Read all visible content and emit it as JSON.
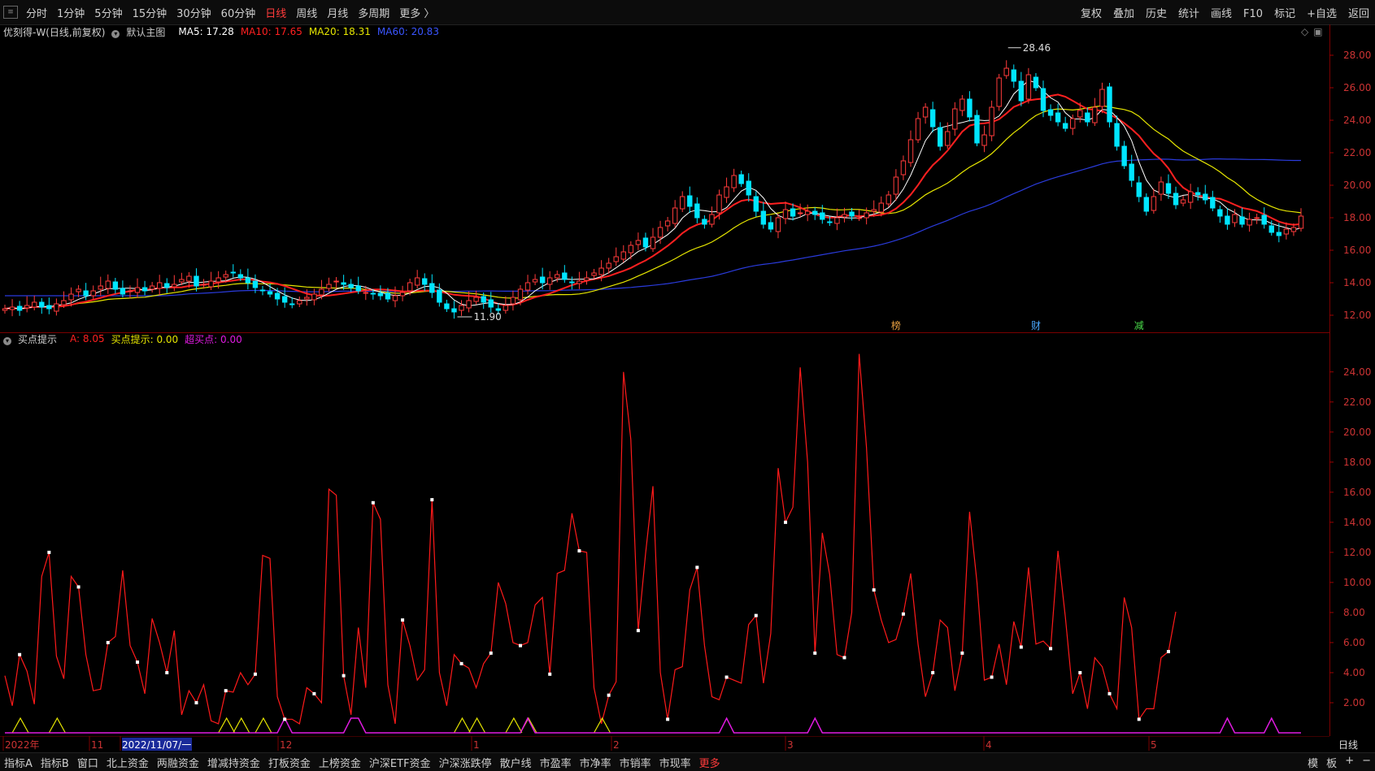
{
  "toolbar": {
    "periods": [
      "分时",
      "1分钟",
      "5分钟",
      "15分钟",
      "30分钟",
      "60分钟",
      "日线",
      "周线",
      "月线",
      "多周期",
      "更多 〉"
    ],
    "active_period": "日线",
    "right_items": [
      "复权",
      "叠加",
      "历史",
      "统计",
      "画线",
      "F10",
      "标记",
      "+自选",
      "返回"
    ]
  },
  "main_panel": {
    "title": "优刻得-W(日线,前复权)",
    "indicator_name": "默认主图",
    "ma5": "MA5: 17.28",
    "ma10": "MA10: 17.65",
    "ma20": "MA20: 18.31",
    "ma60": "MA60: 20.83",
    "high_label": "28.46",
    "low_label": "11.90",
    "y_ticks": [
      "28.00",
      "26.00",
      "24.00",
      "22.00",
      "20.00",
      "18.00",
      "16.00",
      "14.00",
      "12.00"
    ],
    "markers": [
      "榜",
      "财",
      "减"
    ]
  },
  "sub_panel": {
    "indicator_name": "买点提示",
    "a_value": "A: 8.05",
    "buy_hint": "买点提示: 0.00",
    "super_buy": "超买点: 0.00",
    "y_ticks": [
      "24.00",
      "22.00",
      "20.00",
      "18.00",
      "16.00",
      "14.00",
      "12.00",
      "10.00",
      "8.00",
      "6.00",
      "4.00",
      "2.00"
    ]
  },
  "x_axis": {
    "labels": [
      "2022年",
      "11",
      "2022/11/07/一",
      "12",
      "1",
      "2",
      "3",
      "4",
      "5"
    ],
    "period_label": "日线"
  },
  "bottom_tabs": [
    "指标A",
    "指标B",
    "窗口",
    "北上资金",
    "两融资金",
    "增减持资金",
    "打板资金",
    "上榜资金",
    "沪深ETF资金",
    "沪深涨跌停",
    "散户线",
    "市盈率",
    "市净率",
    "市销率",
    "市现率",
    "更多"
  ],
  "bottom_right": [
    "模",
    "板",
    "+",
    "−"
  ],
  "colors": {
    "ma5": "#ffffff",
    "ma10": "#ff2020",
    "ma20": "#e6e600",
    "ma60": "#2a3bdc",
    "up": "#ff3b3b",
    "down": "#00e5ff",
    "indicator": "#ff1a1a",
    "buy": "#e6e600",
    "superbuy": "#e01ae0"
  },
  "chart_data": {
    "type": "candlestick",
    "title": "优刻得-W(日线,前复权)",
    "y_range": [
      11.0,
      29.0
    ],
    "extremes": {
      "high": 28.46,
      "low": 11.9
    },
    "ma_values": {
      "MA5": 17.28,
      "MA10": 17.65,
      "MA20": 18.31,
      "MA60": 20.83
    },
    "closes": [
      12.4,
      12.5,
      12.3,
      12.6,
      12.8,
      12.5,
      12.4,
      12.7,
      12.9,
      13.3,
      13.6,
      13.2,
      13.5,
      13.8,
      14.1,
      13.6,
      13.3,
      13.5,
      13.7,
      13.5,
      13.8,
      14.0,
      13.7,
      13.9,
      14.2,
      14.4,
      13.8,
      13.9,
      14.1,
      14.3,
      14.5,
      14.6,
      14.3,
      14.0,
      13.7,
      13.5,
      13.3,
      13.0,
      12.8,
      12.7,
      12.9,
      13.1,
      13.3,
      13.6,
      13.9,
      14.1,
      13.9,
      13.7,
      13.5,
      13.4,
      13.3,
      13.2,
      13.0,
      13.2,
      13.4,
      14.0,
      14.3,
      13.9,
      13.4,
      12.8,
      12.4,
      12.2,
      12.6,
      12.9,
      13.1,
      12.8,
      12.5,
      12.3,
      12.6,
      13.1,
      13.6,
      14.0,
      14.2,
      14.0,
      14.3,
      14.5,
      14.2,
      14.0,
      14.1,
      14.3,
      14.6,
      14.9,
      15.2,
      15.6,
      15.9,
      16.3,
      16.6,
      16.2,
      16.8,
      17.4,
      17.8,
      18.6,
      19.3,
      18.7,
      18.0,
      17.6,
      18.2,
      19.4,
      19.9,
      20.6,
      20.1,
      19.4,
      18.4,
      17.6,
      17.3,
      18.0,
      18.5,
      18.1,
      18.3,
      18.4,
      18.2,
      17.9,
      17.7,
      18.0,
      18.2,
      18.1,
      18.0,
      18.3,
      18.5,
      18.9,
      19.4,
      20.5,
      21.5,
      22.8,
      24.1,
      24.8,
      23.6,
      22.4,
      23.3,
      24.7,
      25.3,
      24.2,
      22.6,
      23.1,
      24.8,
      26.6,
      27.2,
      26.4,
      25.2,
      26.8,
      26.0,
      24.6,
      24.3,
      23.9,
      23.5,
      24.1,
      24.6,
      23.9,
      24.8,
      25.9,
      23.9,
      22.4,
      21.2,
      20.3,
      19.3,
      18.4,
      19.3,
      20.2,
      19.5,
      18.8,
      19.1,
      19.6,
      19.4,
      19.1,
      18.6,
      18.1,
      17.6,
      18.2,
      17.6,
      17.9,
      18.0,
      17.6,
      17.1,
      16.9,
      17.3,
      17.4,
      18.1
    ],
    "indicator_A": [
      3.8,
      1.8,
      5.2,
      4.1,
      1.9,
      10.4,
      12.0,
      5.1,
      3.6,
      10.4,
      9.7,
      5.2,
      2.8,
      2.9,
      6.0,
      6.4,
      10.8,
      5.8,
      4.7,
      2.6,
      7.6,
      6.0,
      4.0,
      6.8,
      1.2,
      2.8,
      2.0,
      3.2,
      0.8,
      0.6,
      2.8,
      2.7,
      4.0,
      3.2,
      3.9,
      11.8,
      11.6,
      2.4,
      0.9,
      0.9,
      0.6,
      3.0,
      2.6,
      2.0,
      16.2,
      15.8,
      3.8,
      1.2,
      7.0,
      3.0,
      15.3,
      14.2,
      3.2,
      0.6,
      7.5,
      5.8,
      3.5,
      4.2,
      15.5,
      4.0,
      1.8,
      5.2,
      4.6,
      4.3,
      3.0,
      4.6,
      5.3,
      10.0,
      8.6,
      6.0,
      5.8,
      6.0,
      8.5,
      9.0,
      3.9,
      10.6,
      10.8,
      14.6,
      12.1,
      12.0,
      3.0,
      0.6,
      2.5,
      3.4,
      24.0,
      19.5,
      6.8,
      11.9,
      16.4,
      4.0,
      0.9,
      4.2,
      4.4,
      9.5,
      11.0,
      5.8,
      2.4,
      2.2,
      3.7,
      3.5,
      3.3,
      7.2,
      7.8,
      3.3,
      6.6,
      17.6,
      14.0,
      15.0,
      24.3,
      18.0,
      5.3,
      13.3,
      10.5,
      5.2,
      5.0,
      8.0,
      25.2,
      19.0,
      9.5,
      7.5,
      6.0,
      6.2,
      7.9,
      10.6,
      5.9,
      2.4,
      4.0,
      7.5,
      7.0,
      2.8,
      5.3,
      14.7,
      10.0,
      3.5,
      3.7,
      5.9,
      3.2,
      7.4,
      5.7,
      11.0,
      5.9,
      6.1,
      5.6,
      12.1,
      7.7,
      2.6,
      4.0,
      1.6,
      5.0,
      4.4,
      2.6,
      1.6,
      9.0,
      7.0,
      0.9,
      1.6,
      1.6,
      5.0,
      5.4,
      8.05
    ],
    "buy_hint_current": 0.0,
    "superbuy_current": 0.0
  }
}
